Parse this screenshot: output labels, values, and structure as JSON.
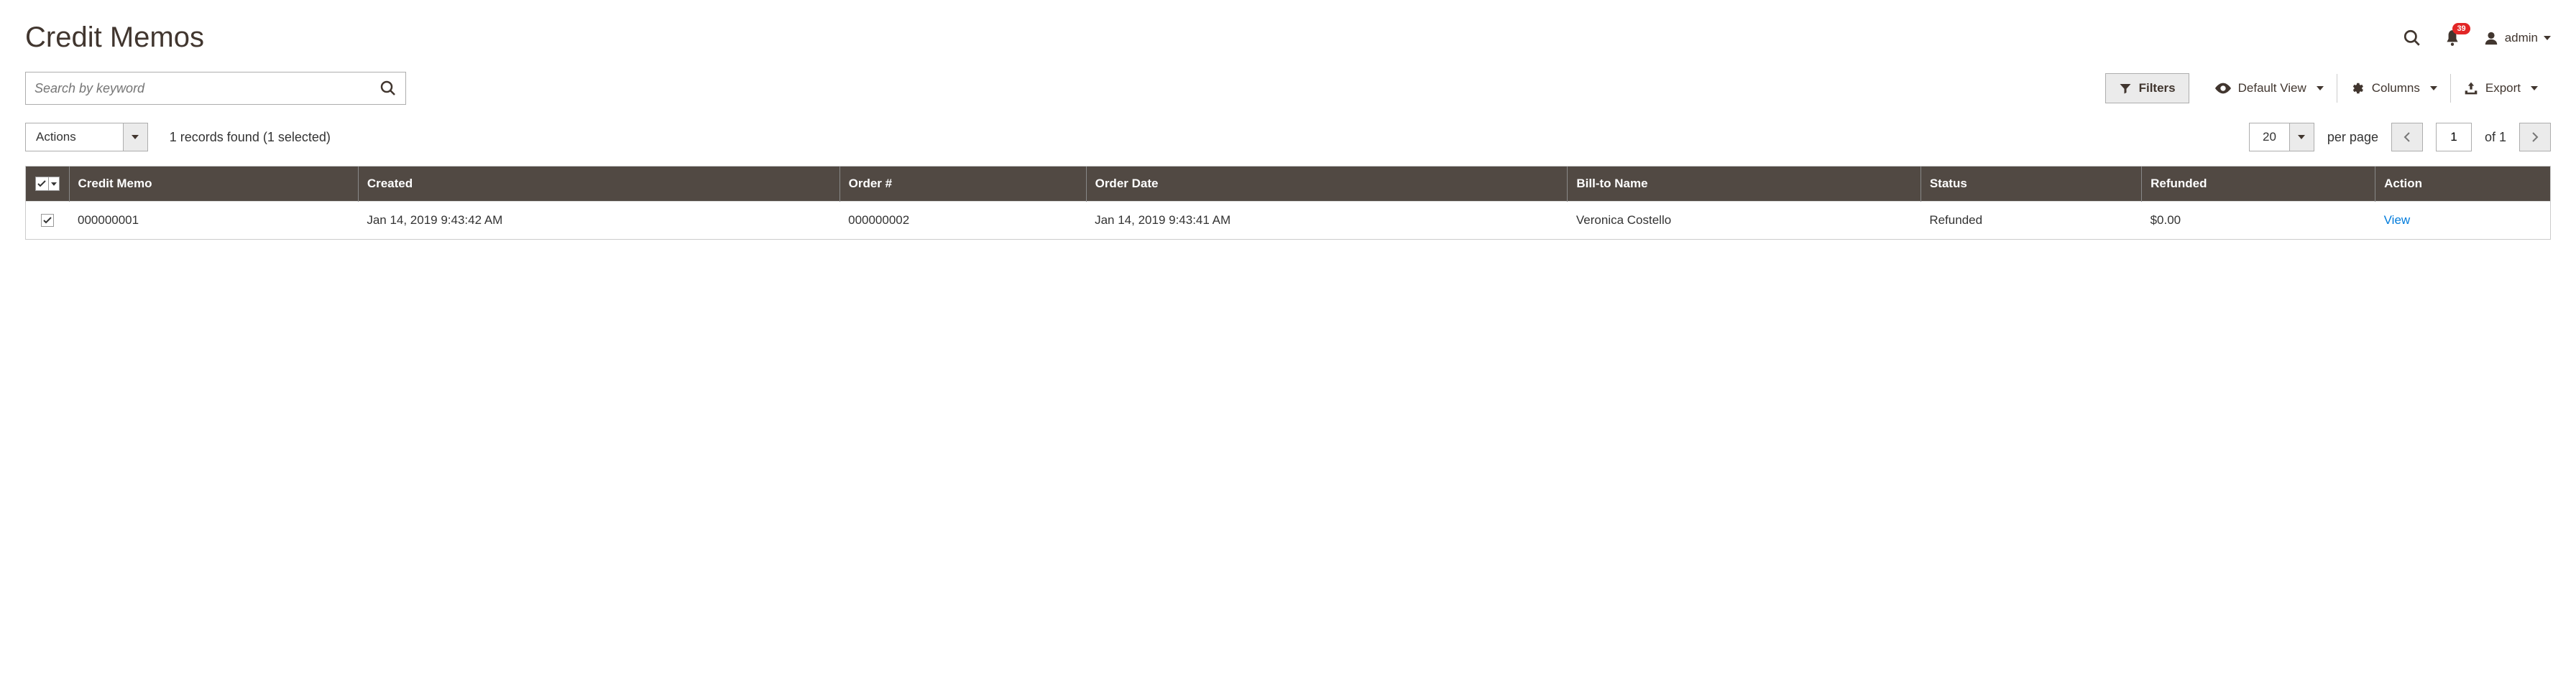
{
  "header": {
    "title": "Credit Memos",
    "notification_count": "39",
    "user_label": "admin"
  },
  "search": {
    "placeholder": "Search by keyword"
  },
  "toolbar": {
    "filters": "Filters",
    "default_view": "Default View",
    "columns": "Columns",
    "export": "Export"
  },
  "controls": {
    "actions_label": "Actions",
    "records_text": "1 records found (1 selected)",
    "page_size": "20",
    "per_page_label": "per page",
    "current_page": "1",
    "of_label": "of 1"
  },
  "columns": {
    "credit_memo": "Credit Memo",
    "created": "Created",
    "order_num": "Order #",
    "order_date": "Order Date",
    "bill_to": "Bill-to Name",
    "status": "Status",
    "refunded": "Refunded",
    "action": "Action"
  },
  "rows": [
    {
      "selected": true,
      "credit_memo": "000000001",
      "created": "Jan 14, 2019 9:43:42 AM",
      "order_num": "000000002",
      "order_date": "Jan 14, 2019 9:43:41 AM",
      "bill_to": "Veronica Costello",
      "status": "Refunded",
      "refunded": "$0.00",
      "action_label": "View"
    }
  ]
}
